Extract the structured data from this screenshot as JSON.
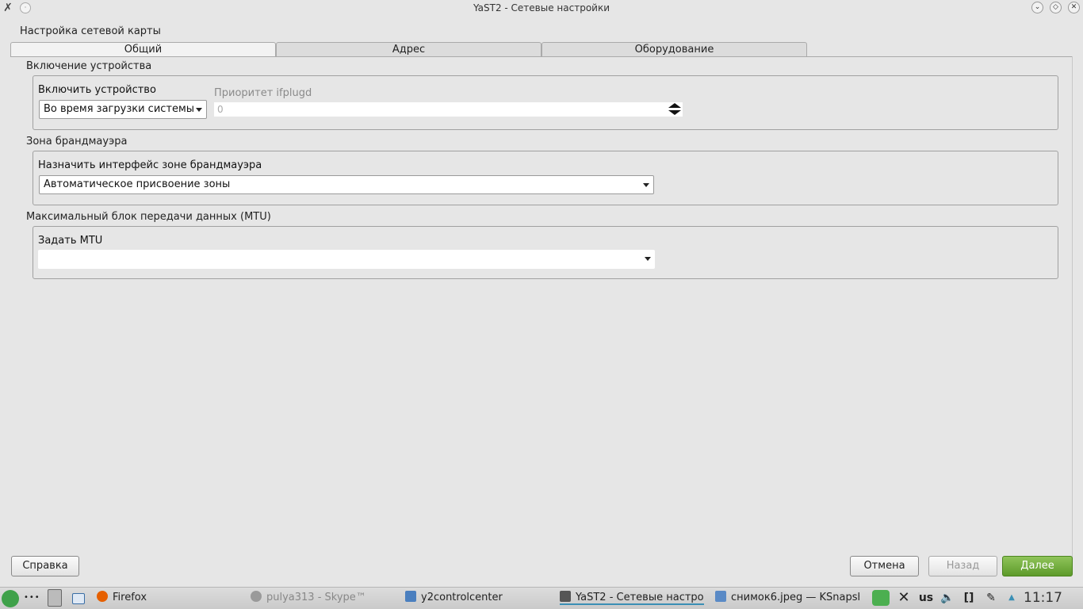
{
  "window": {
    "title": "YaST2 - Сетевые настройки",
    "menu_glyph": "·",
    "controls": {
      "minimize": "⌄",
      "maximize": "◇",
      "close": "✕"
    }
  },
  "page": {
    "heading": "Настройка сетевой карты"
  },
  "tabs": [
    {
      "label": "Общий",
      "active": true
    },
    {
      "label": "Адрес",
      "active": false
    },
    {
      "label": "Оборудование",
      "active": false
    }
  ],
  "device_activation": {
    "group_title": "Включение устройства",
    "enable_label": "Включить устройство",
    "enable_value": "Во время загрузки системы",
    "priority_label": "Приоритет ifplugd",
    "priority_value": "0"
  },
  "firewall": {
    "group_title": "Зона брандмауэра",
    "assign_label": "Назначить интерфейс зоне брандмауэра",
    "assign_value": "Автоматическое присвоение зоны"
  },
  "mtu": {
    "group_title": "Максимальный блок передачи данных (MTU)",
    "set_label": "Задать MTU",
    "set_value": ""
  },
  "buttons": {
    "help": "Справка",
    "cancel": "Отмена",
    "back": "Назад",
    "next": "Далее"
  },
  "taskbar": {
    "dots": "•••",
    "items": [
      {
        "label": "Firefox",
        "icon": "firefox-icon",
        "color": "#e66000"
      },
      {
        "label": "pulya313 - Skype™",
        "icon": "skype-icon",
        "color": "#9a9a9a"
      },
      {
        "label": "y2controlcenter",
        "icon": "yast-icon",
        "color": "#4a7fbf"
      },
      {
        "label": "YaST2 - Сетевые настро",
        "icon": "yast-icon",
        "color": "#555555"
      },
      {
        "label": "снимок6.jpeg — KSnapsh",
        "icon": "ksnapshot-icon",
        "color": "#5a8ac6"
      }
    ],
    "tray": {
      "keyboard_layout": "us",
      "clock": "11:17"
    }
  },
  "colors": {
    "accent_green": "#5d9a2a",
    "active_task_line": "#3a8fb5"
  }
}
